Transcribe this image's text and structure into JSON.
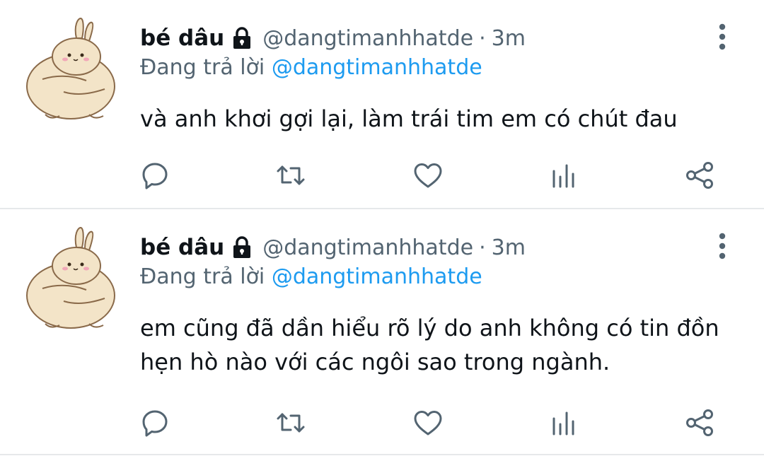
{
  "tweets": [
    {
      "name": "bé dâu",
      "handle": "@dangtimanhhatde",
      "separator": "·",
      "time": "3m",
      "replying_prefix": "Đang trả lời",
      "replying_to": "@dangtimanhhatde",
      "text": "và anh khơi gợi lại, làm trái tim em có chút đau"
    },
    {
      "name": "bé dâu",
      "handle": "@dangtimanhhatde",
      "separator": "·",
      "time": "3m",
      "replying_prefix": "Đang trả lời",
      "replying_to": "@dangtimanhhatde",
      "text_line1": "em cũng đã dần hiểu rõ lý do anh không có tin đồn",
      "text_line2": "hẹn hò nào với các ngôi sao trong ngành."
    }
  ],
  "icons": {
    "reply": "reply-icon",
    "retweet": "retweet-icon",
    "like": "heart-icon",
    "views": "views-icon",
    "share": "share-icon",
    "lock": "lock-icon",
    "menu": "more-vertical-icon"
  },
  "colors": {
    "text_primary": "#0f1419",
    "text_secondary": "#536471",
    "mention": "#1d9bf0",
    "divider": "#e6e8ea"
  }
}
